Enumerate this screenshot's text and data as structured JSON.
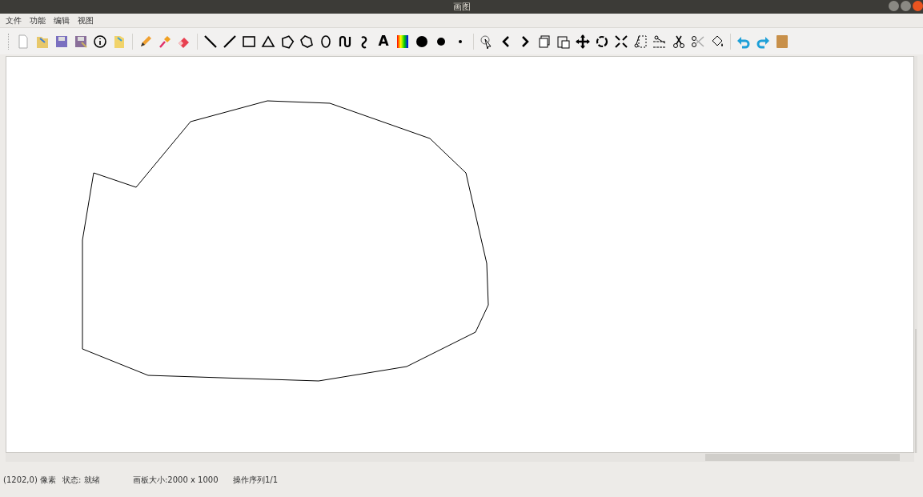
{
  "window": {
    "title": "画图"
  },
  "menu": [
    "文件",
    "功能",
    "编辑",
    "视图"
  ],
  "toolbar": {
    "text_tool_glyph": "A"
  },
  "status_bar": {
    "position": "(1202,0) 像素",
    "state": "状态: 就绪",
    "canvas_size": "画板大小:2000 x 1000",
    "history": "操作序列1/1"
  }
}
